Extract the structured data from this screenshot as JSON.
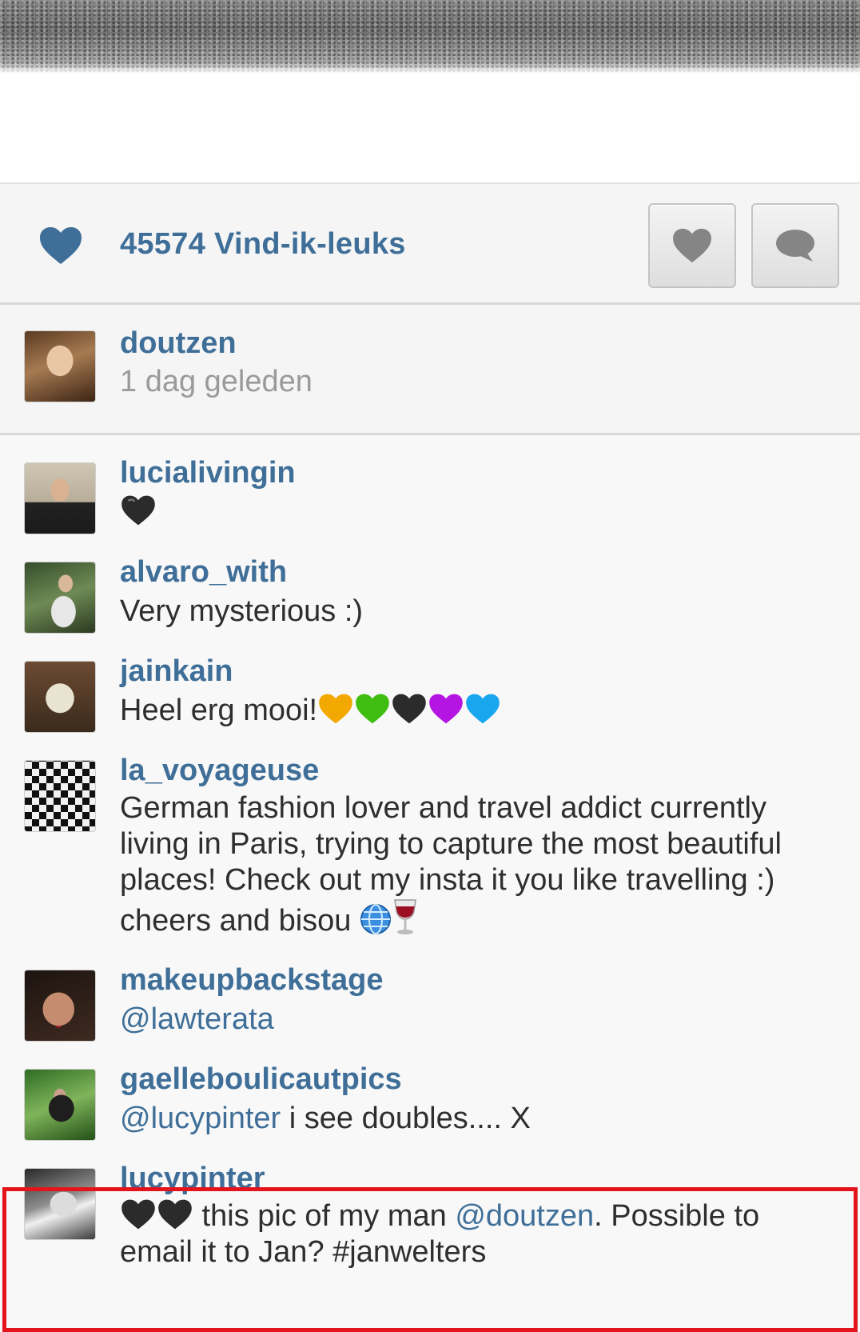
{
  "likes": {
    "count_text": "45574 Vind-ik-leuks",
    "heart_color": "#3f6f98"
  },
  "actions": {
    "like_icon": "heart-icon",
    "comment_icon": "speech-bubble-icon"
  },
  "caption": {
    "username": "doutzen",
    "time": "1 dag geleden"
  },
  "comments": [
    {
      "username": "lucialivingin",
      "text": "",
      "emoji": [
        "black-heart"
      ]
    },
    {
      "username": "alvaro_with",
      "text": "Very mysterious :)"
    },
    {
      "username": "jainkain",
      "text": "Heel erg mooi!",
      "emoji": [
        "yellow-heart",
        "green-heart",
        "black-heart",
        "purple-heart",
        "blue-heart"
      ]
    },
    {
      "username": "la_voyageuse",
      "text": "German fashion lover and travel addict currently living in Paris, trying to capture the most beautiful places! Check out my insta it you like travelling :) cheers and bisou",
      "emoji": [
        "globe",
        "wine-glass"
      ]
    },
    {
      "username": "makeupbackstage",
      "mention": "@lawterata"
    },
    {
      "username": "gaelleboulicautpics",
      "mention": "@lucypinter",
      "text": " i see doubles.... X"
    },
    {
      "username": "lucypinter",
      "text_before": " this pic of my man ",
      "mention": "@doutzen",
      "text_after": ". Possible to email it to Jan? #janwelters",
      "emoji": [
        "black-heart",
        "black-heart"
      ]
    }
  ],
  "colors": {
    "link": "#3f6f98",
    "highlight": "#e3141c",
    "text": "#2e2e2e",
    "muted": "#9a9a9a"
  }
}
